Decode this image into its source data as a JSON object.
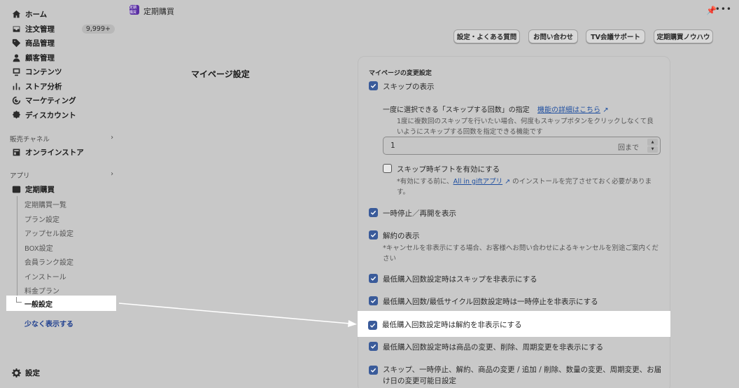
{
  "sidebar": {
    "nav": [
      {
        "label": "ホーム",
        "icon": "home-icon"
      },
      {
        "label": "注文管理",
        "icon": "inbox-icon",
        "badge": "9,999+"
      },
      {
        "label": "商品管理",
        "icon": "tag-icon"
      },
      {
        "label": "顧客管理",
        "icon": "person-icon"
      },
      {
        "label": "コンテンツ",
        "icon": "content-icon"
      },
      {
        "label": "ストア分析",
        "icon": "chart-icon"
      },
      {
        "label": "マーケティング",
        "icon": "target-icon"
      },
      {
        "label": "ディスカウント",
        "icon": "discount-icon"
      }
    ],
    "sales_channel_heading": "販売チャネル",
    "online_store": "オンラインストア",
    "apps_heading": "アプリ",
    "app_name": "定期購買",
    "sub_items": [
      "定期購買一覧",
      "プラン設定",
      "アップセル設定",
      "BOX設定",
      "会員ランク設定",
      "インストール",
      "料金プラン"
    ],
    "active_sub": "一般設定",
    "show_less": "少なく表示する",
    "settings": "設定"
  },
  "topbar": {
    "app_icon_text": "定期購買",
    "title": "定期購買"
  },
  "header_buttons": [
    "設定・よくある質問",
    "お問い合わせ",
    "TV会議サポート",
    "定期購買ノウハウ"
  ],
  "section_title": "マイページ設定",
  "card": {
    "title": "マイページの変更設定",
    "skip_display": "スキップの表示",
    "skip_count_label": "一度に選択できる「スキップする回数」の指定",
    "skip_count_link": "機能の詳細はこちら",
    "skip_count_help": "1度に複数回のスキップを行いたい場合、何度もスキップボタンをクリックしなくて良いようにスキップする回数を指定できる機能です",
    "skip_count_value": "1",
    "skip_count_suffix": "回まで",
    "gift_label": "スキップ時ギフトを有効にする",
    "gift_help_prefix": "*有効にする前に、",
    "gift_help_link": "All in giftアプリ",
    "gift_help_suffix": "のインストールを完了させておく必要があります。",
    "pause_label": "一時停止／再開を表示",
    "cancel_label": "解約の表示",
    "cancel_help": "*キャンセルを非表示にする場合、お客様へお問い合わせによるキャンセルを別途ご案内ください",
    "min_skip_label": "最低購入回数設定時はスキップを非表示にする",
    "min_pause_label": "最低購入回数/最低サイクル回数設定時は一時停止を非表示にする",
    "min_cancel_label": "最低購入回数設定時は解約を非表示にする",
    "min_product_label": "最低購入回数設定時は商品の変更、削除、周期変更を非表示にする",
    "change_date_label": "スキップ、一時停止、解約、商品の変更 / 追加 / 削除、数量の変更、周期変更、お届け日の変更可能日設定"
  }
}
